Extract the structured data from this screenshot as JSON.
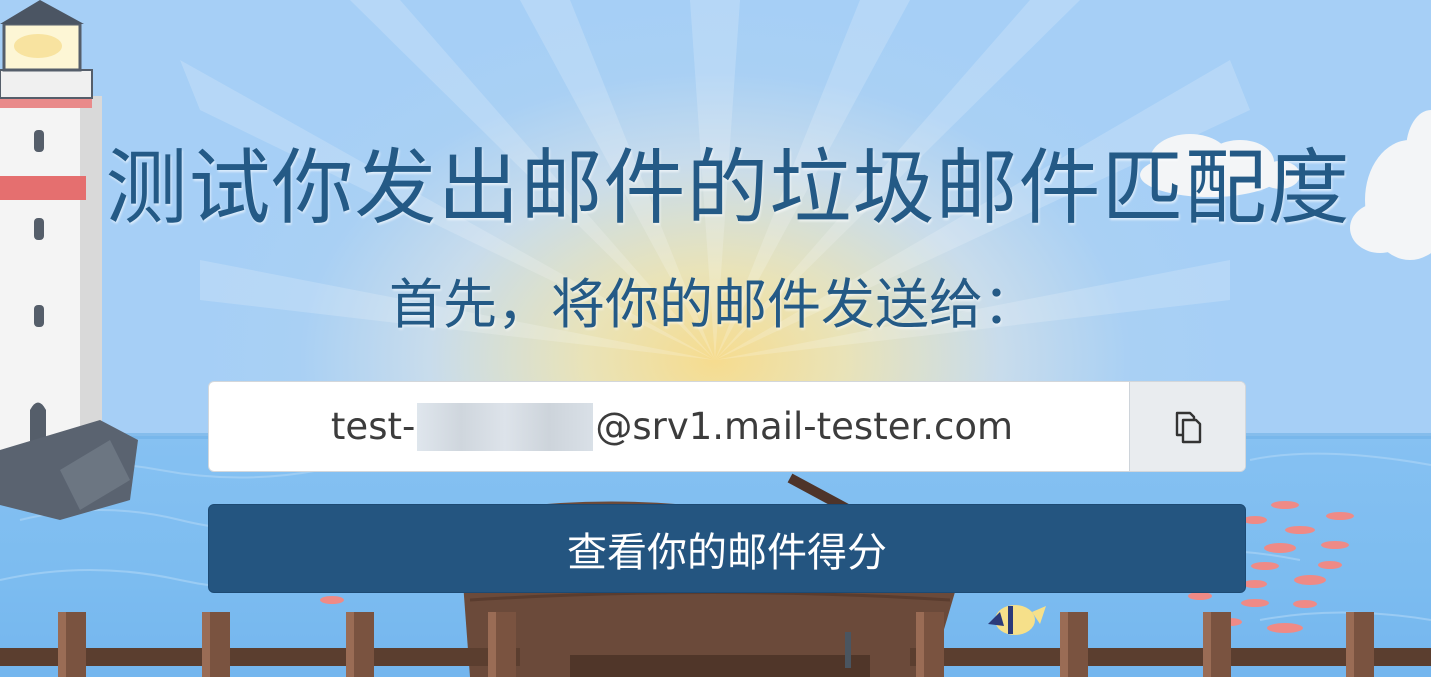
{
  "heading": "测试你发出邮件的垃圾邮件匹配度",
  "subheading": "首先，将你的邮件发送给：",
  "email": {
    "prefix": "test-",
    "domain": "@srv1.mail-tester.com"
  },
  "copy_button_icon": "copy-icon",
  "score_button_label": "查看你的邮件得分",
  "colors": {
    "primary": "#245580",
    "heading": "#245a86",
    "sky": "#a6cff6",
    "sea": "#7cbcf0",
    "sun": "#f6dc8f"
  }
}
